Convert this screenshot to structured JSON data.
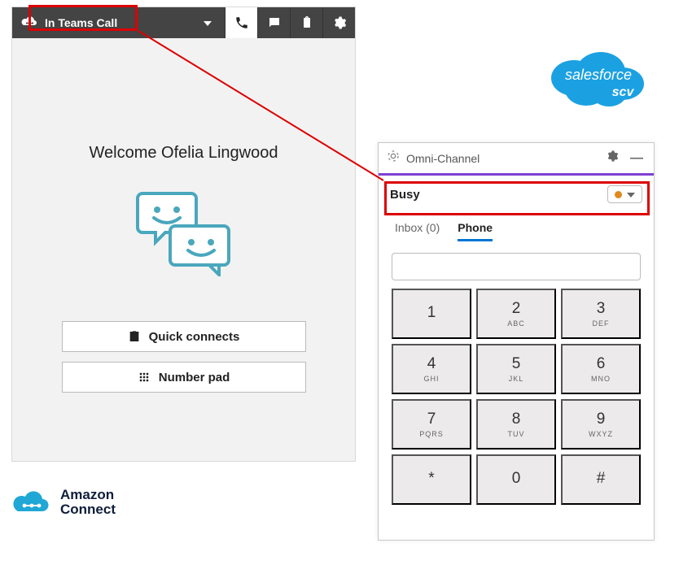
{
  "connect": {
    "status_label": "In Teams Call",
    "welcome": "Welcome Ofelia Lingwood",
    "quick_connects_label": "Quick connects",
    "number_pad_label": "Number pad"
  },
  "amazon_logo": {
    "line1": "Amazon",
    "line2": "Connect"
  },
  "salesforce_logo": {
    "top": "salesforce",
    "bottom": "scv"
  },
  "omni": {
    "title": "Omni-Channel",
    "status": "Busy",
    "tabs": {
      "inbox": "Inbox (0)",
      "phone": "Phone"
    },
    "dial_input": "",
    "keys": [
      {
        "num": "1",
        "letters": ""
      },
      {
        "num": "2",
        "letters": "ABC"
      },
      {
        "num": "3",
        "letters": "DEF"
      },
      {
        "num": "4",
        "letters": "GHI"
      },
      {
        "num": "5",
        "letters": "JKL"
      },
      {
        "num": "6",
        "letters": "MNO"
      },
      {
        "num": "7",
        "letters": "PQRS"
      },
      {
        "num": "8",
        "letters": "TUV"
      },
      {
        "num": "9",
        "letters": "WXYZ"
      },
      {
        "num": "*",
        "letters": ""
      },
      {
        "num": "0",
        "letters": ""
      },
      {
        "num": "#",
        "letters": ""
      }
    ]
  }
}
